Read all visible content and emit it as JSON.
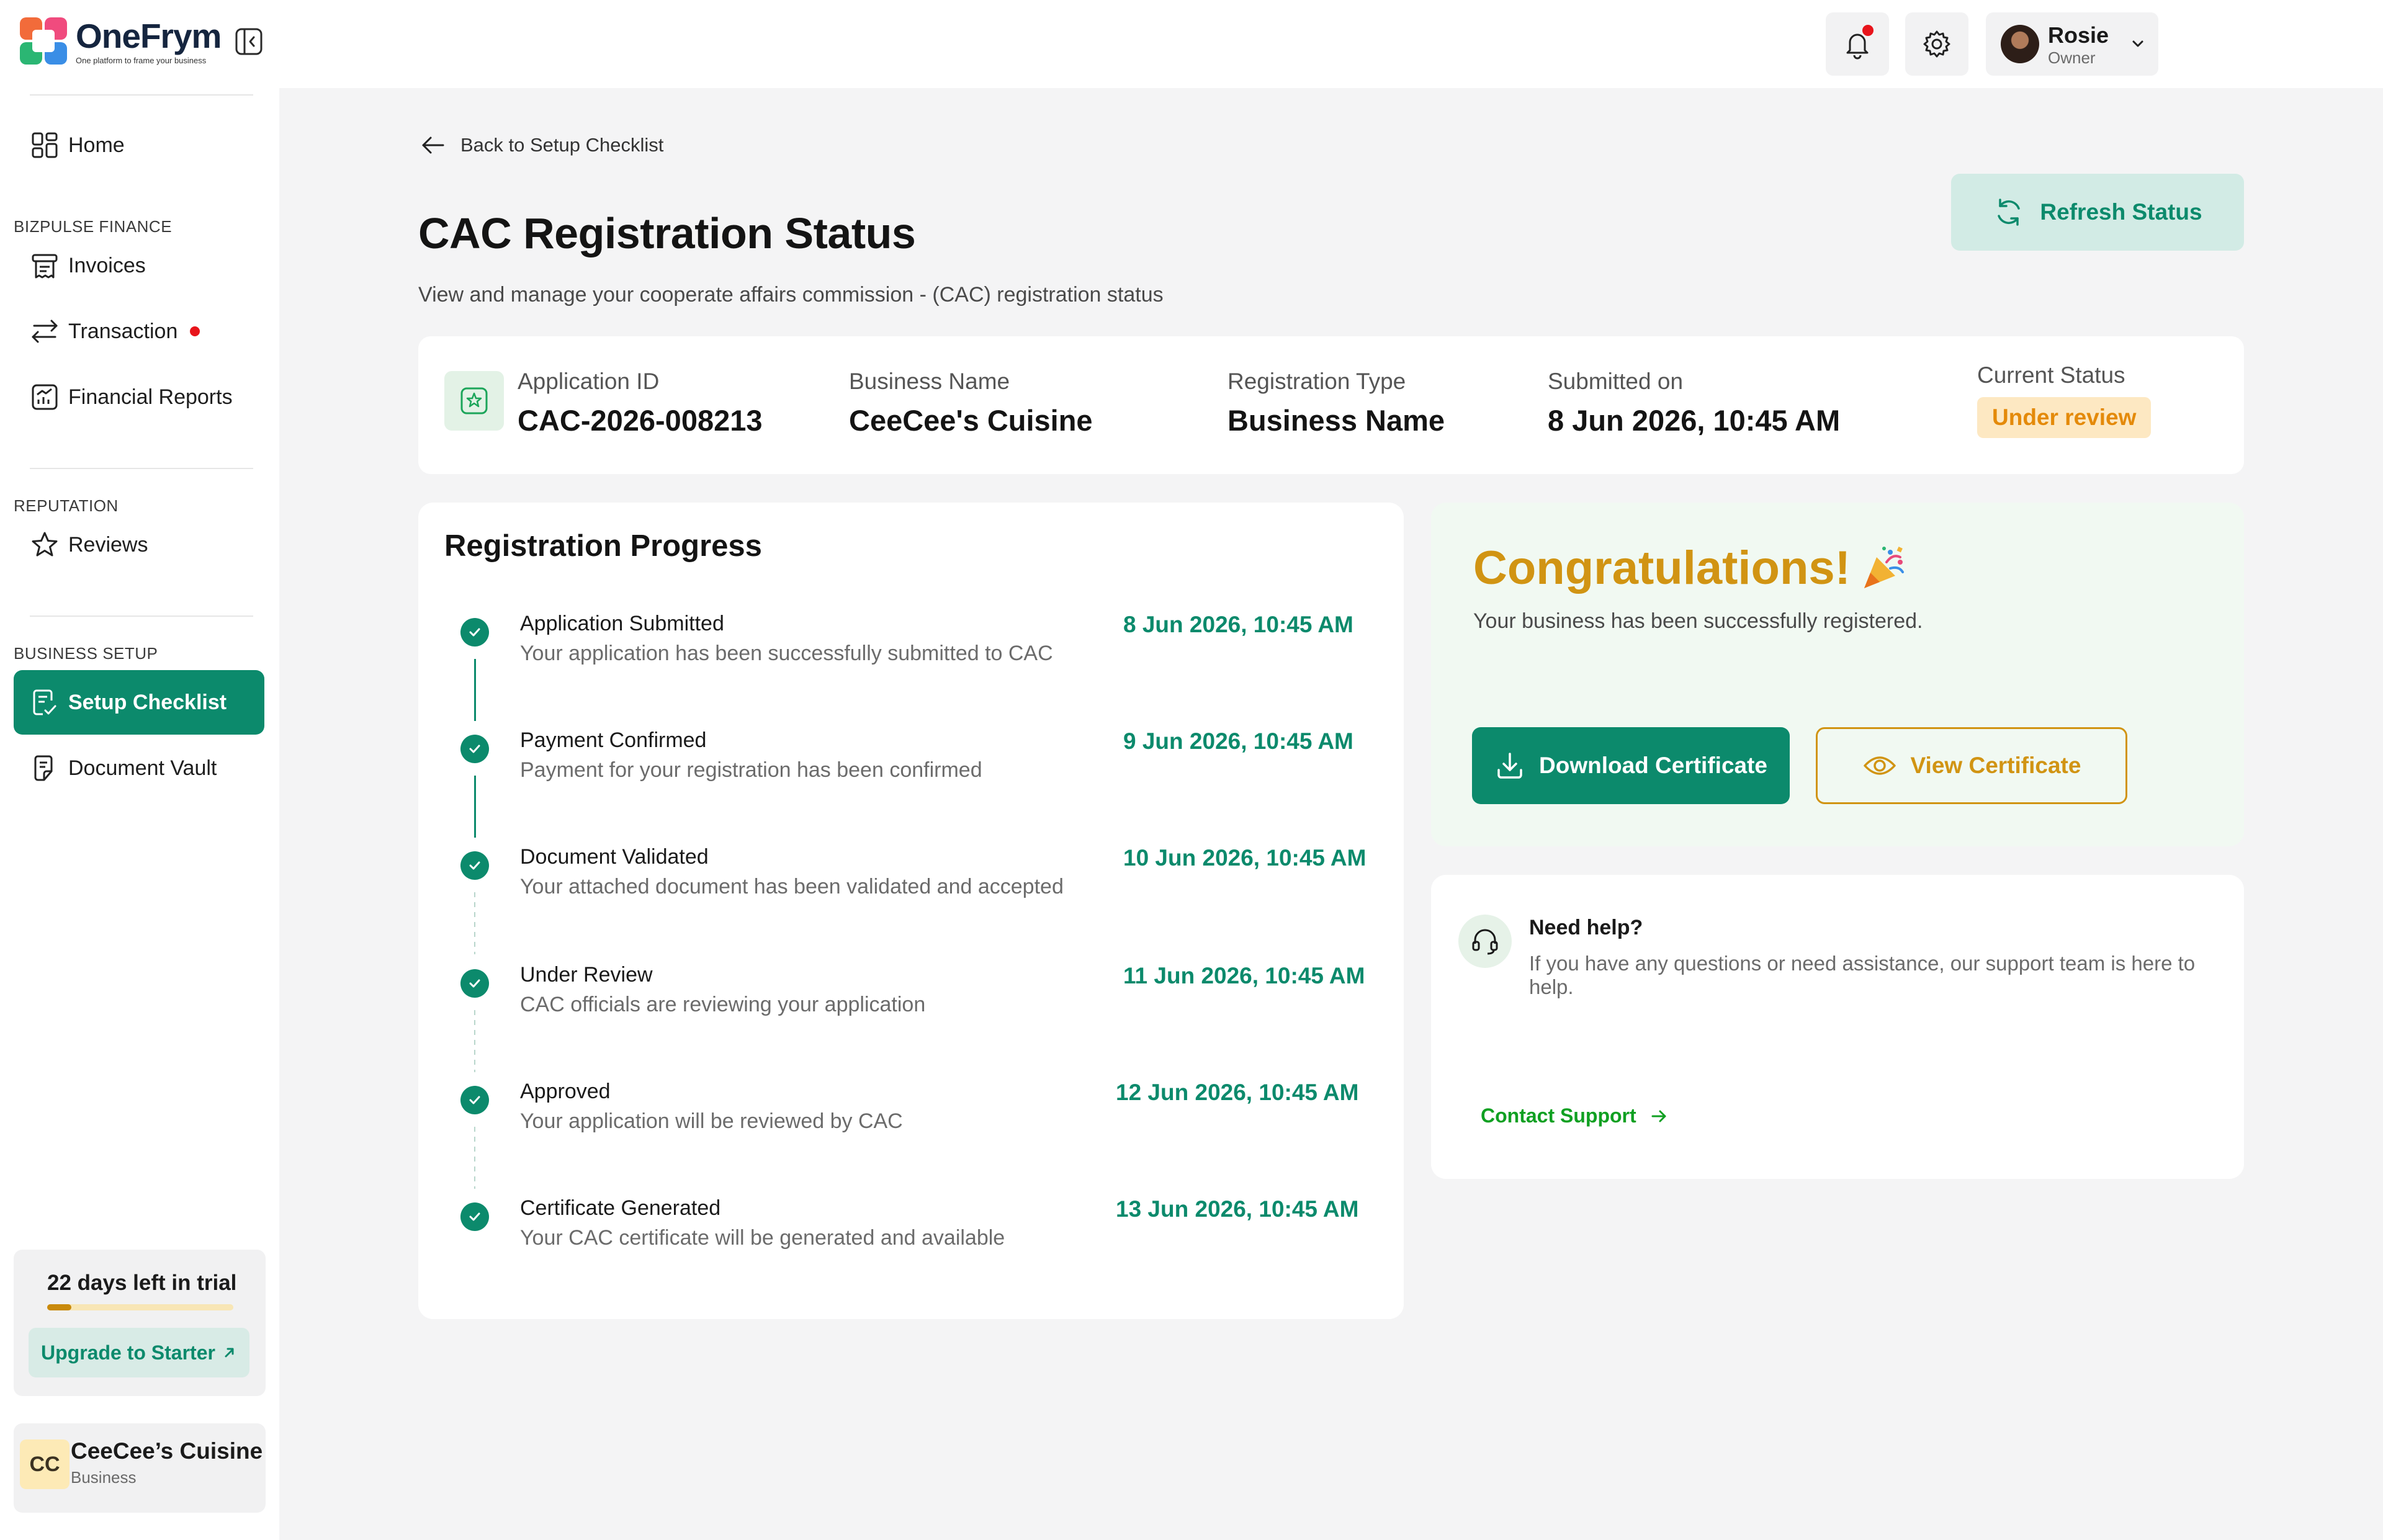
{
  "app": {
    "name": "OneFrym",
    "tagline": "One platform to frame your business"
  },
  "header": {
    "user_name": "Rosie",
    "user_role": "Owner"
  },
  "sidebar": {
    "home_label": "Home",
    "sections": [
      {
        "title": "BIZPULSE FINANCE",
        "items": [
          {
            "label": "Invoices"
          },
          {
            "label": "Transaction"
          },
          {
            "label": "Financial Reports"
          }
        ]
      },
      {
        "title": "REPUTATION",
        "items": [
          {
            "label": "Reviews"
          }
        ]
      },
      {
        "title": "BUSINESS SETUP",
        "items": [
          {
            "label": "Setup Checklist",
            "active": true
          },
          {
            "label": "Document Vault"
          }
        ]
      }
    ],
    "trial": {
      "text": "22 days left in trial",
      "progress_fraction": 0.13,
      "upgrade_label": "Upgrade to Starter"
    },
    "business": {
      "initials": "CC",
      "name": "CeeCee’s Cuisine",
      "type": "Business"
    }
  },
  "main": {
    "back_label": "Back to Setup Checklist",
    "title": "CAC Registration Status",
    "subtitle": "View and manage your cooperate affairs commission - (CAC) registration status",
    "refresh_label": "Refresh Status",
    "summary": {
      "application_id_label": "Application ID",
      "application_id": "CAC-2026-008213",
      "business_name_label": "Business Name",
      "business_name": "CeeCee's Cuisine",
      "registration_type_label": "Registration Type",
      "registration_type": "Business Name",
      "submitted_label": "Submitted on",
      "submitted": "8 Jun 2026, 10:45 AM",
      "status_label": "Current Status",
      "status": "Under review"
    },
    "progress": {
      "title": "Registration Progress",
      "steps": [
        {
          "title": "Application Submitted",
          "desc": "Your application has been successfully submitted to CAC",
          "date": "8 Jun 2026, 10:45 AM"
        },
        {
          "title": "Payment Confirmed",
          "desc": "Payment for your registration has been confirmed",
          "date": "9 Jun 2026, 10:45 AM"
        },
        {
          "title": "Document Validated",
          "desc": "Your attached document has been validated and accepted",
          "date": "10 Jun 2026, 10:45 AM"
        },
        {
          "title": "Under Review",
          "desc": "CAC officials are reviewing your application",
          "date": "11 Jun 2026, 10:45 AM"
        },
        {
          "title": "Approved",
          "desc": "Your application will be reviewed by CAC",
          "date": "12 Jun 2026, 10:45 AM"
        },
        {
          "title": "Certificate Generated",
          "desc": "Your CAC certificate will be generated and available",
          "date": "13 Jun 2026, 10:45 AM"
        }
      ]
    },
    "congrats": {
      "title": "Congratulations!",
      "subtitle": "Your business has been successfully registered.",
      "download_label": "Download Certificate",
      "view_label": "View Certificate"
    },
    "help": {
      "title": "Need help?",
      "desc": "If you have any questions or need assistance, our support team is here to help.",
      "contact_label": "Contact Support"
    }
  },
  "colors": {
    "primary": "#0c8a6c",
    "accent": "#d19413",
    "status_bg": "#fde8c2",
    "status_text": "#e48a0a",
    "notification": "#e8141b"
  }
}
